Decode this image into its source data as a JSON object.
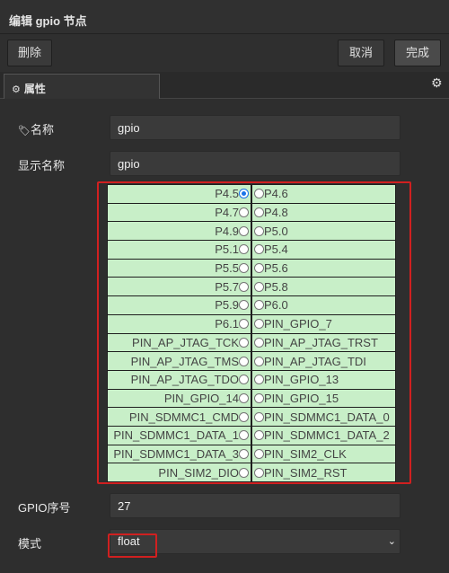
{
  "title": "编辑 gpio 节点",
  "toolbar": {
    "delete": "删除",
    "cancel": "取消",
    "done": "完成"
  },
  "tab": {
    "label": "属性"
  },
  "fields": {
    "name_label": "名称",
    "name_value": "gpio",
    "display_label": "显示名称",
    "display_value": "gpio",
    "seq_label": "GPIO序号",
    "seq_value": "27",
    "mode_label": "模式",
    "mode_value": "float"
  },
  "pins": {
    "selected": "P4.5",
    "rows": [
      [
        "P4.5",
        "P4.6"
      ],
      [
        "P4.7",
        "P4.8"
      ],
      [
        "P4.9",
        "P5.0"
      ],
      [
        "P5.1",
        "P5.4"
      ],
      [
        "P5.5",
        "P5.6"
      ],
      [
        "P5.7",
        "P5.8"
      ],
      [
        "P5.9",
        "P6.0"
      ],
      [
        "P6.1",
        "PIN_GPIO_7"
      ],
      [
        "PIN_AP_JTAG_TCK",
        "PIN_AP_JTAG_TRST"
      ],
      [
        "PIN_AP_JTAG_TMS",
        "PIN_AP_JTAG_TDI"
      ],
      [
        "PIN_AP_JTAG_TDO",
        "PIN_GPIO_13"
      ],
      [
        "PIN_GPIO_14",
        "PIN_GPIO_15"
      ],
      [
        "PIN_SDMMC1_CMD",
        "PIN_SDMMC1_DATA_0"
      ],
      [
        "PIN_SDMMC1_DATA_1",
        "PIN_SDMMC1_DATA_2"
      ],
      [
        "PIN_SDMMC1_DATA_3",
        "PIN_SIM2_CLK"
      ],
      [
        "PIN_SIM2_DIO",
        "PIN_SIM2_RST"
      ]
    ]
  }
}
